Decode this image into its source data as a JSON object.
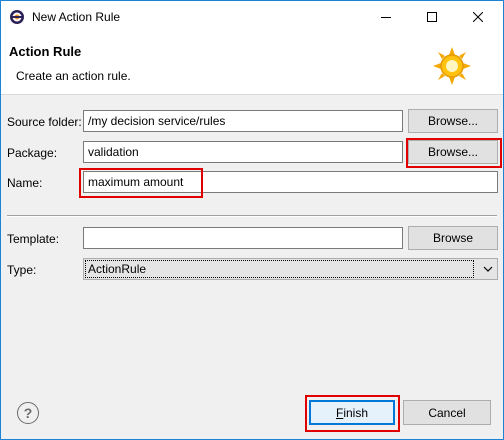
{
  "window": {
    "title": "New Action Rule",
    "border_color": "#1883d7"
  },
  "banner": {
    "title": "Action Rule",
    "description": "Create an action rule.",
    "icon": "gear-sun-icon"
  },
  "form": {
    "source_folder": {
      "label": "Source folder:",
      "value": "/my decision service/rules",
      "browse_label": "Browse..."
    },
    "package": {
      "label": "Package:",
      "value": "validation",
      "browse_label": "Browse..."
    },
    "name": {
      "label": "Name:",
      "value": "maximum amount"
    },
    "template": {
      "label": "Template:",
      "value": "",
      "browse_label": "Browse"
    },
    "type": {
      "label": "Type:",
      "selected": "ActionRule"
    }
  },
  "footer": {
    "help_symbol": "?",
    "finish_label": "Finish",
    "cancel_label": "Cancel"
  },
  "colors": {
    "highlight": "#e00000",
    "accent": "#0078d7"
  }
}
